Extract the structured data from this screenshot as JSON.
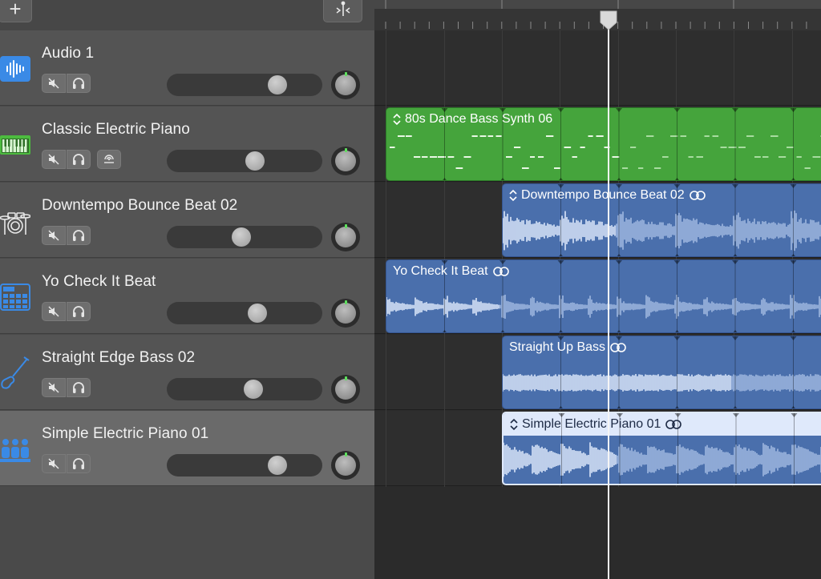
{
  "header": {
    "add_track_label": "+",
    "add_track_icon": "plus-icon",
    "catch_icon": "playhead-catch-icon"
  },
  "tracks": [
    {
      "name": "Audio 1",
      "icon": "waveform-icon",
      "icon_color": "#3a8ae6",
      "volume": 0.7,
      "has_monitor": false,
      "selected": false
    },
    {
      "name": "Classic Electric Piano",
      "icon": "keyboard-icon",
      "icon_color": "#4cbb3f",
      "volume": 0.56,
      "has_monitor": true,
      "selected": false
    },
    {
      "name": "Downtempo Bounce Beat 02",
      "icon": "drum-kit-icon",
      "icon_color": "#e8e8e8",
      "volume": 0.48,
      "has_monitor": false,
      "selected": false
    },
    {
      "name": "Yo Check It Beat",
      "icon": "drum-machine-icon",
      "icon_color": "#3a8ae6",
      "volume": 0.58,
      "has_monitor": false,
      "selected": false
    },
    {
      "name": "Straight Edge Bass 02",
      "icon": "bass-guitar-icon",
      "icon_color": "#3a8ae6",
      "volume": 0.56,
      "has_monitor": false,
      "selected": false
    },
    {
      "name": "Simple Electric Piano 01",
      "icon": "band-icon",
      "icon_color": "#3a8ae6",
      "volume": 0.7,
      "has_monitor": false,
      "selected": true
    }
  ],
  "regions": [
    {
      "track": 1,
      "name": "80s Dance Bass Synth 06",
      "type": "midi",
      "color": "#45a43c",
      "show_arrows": true,
      "show_loop_icon": false
    },
    {
      "track": 2,
      "name": "Downtempo Bounce Beat 02",
      "type": "audio",
      "color": "#4a6fac",
      "show_arrows": true,
      "show_loop_icon": true
    },
    {
      "track": 3,
      "name": "Yo Check It Beat",
      "type": "audio",
      "color": "#4a6fac",
      "show_arrows": false,
      "show_loop_icon": true
    },
    {
      "track": 4,
      "name": "Straight Up Bass",
      "type": "audio",
      "color": "#4a6fac",
      "show_arrows": false,
      "show_loop_icon": true
    },
    {
      "track": 5,
      "name": "Simple Electric Piano 01",
      "type": "audio",
      "color": "#4a6fac",
      "show_arrows": true,
      "show_loop_icon": true
    }
  ],
  "colors": {
    "midi_region": "#45a43c",
    "audio_region": "#4a6fac",
    "waveform_light": "#d7e4f8",
    "playhead": "#f5f5f5"
  }
}
